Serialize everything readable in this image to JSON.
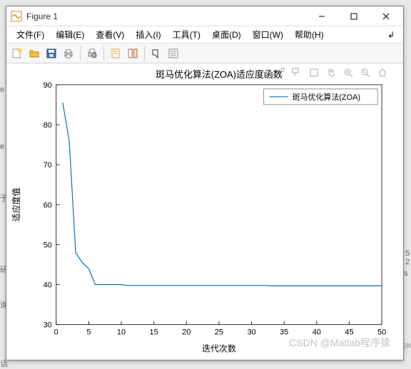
{
  "window": {
    "title": "Figure 1"
  },
  "menu": {
    "file": "文件(F)",
    "edit": "编辑(E)",
    "view": "查看(V)",
    "insert": "插入(I)",
    "tools": "工具(T)",
    "desktop": "桌面(D)",
    "window": "窗口(W)",
    "help": "帮助(H)"
  },
  "watermark": "CSDN @Matlab程序猿",
  "chart_data": {
    "type": "line",
    "title": "斑马优化算法(ZOA)适应度函数",
    "xlabel": "迭代次数",
    "ylabel": "适应度值",
    "xlim": [
      0,
      50
    ],
    "ylim": [
      30,
      90
    ],
    "xticks": [
      0,
      5,
      10,
      15,
      20,
      25,
      30,
      35,
      40,
      45,
      50
    ],
    "yticks": [
      30,
      40,
      50,
      60,
      70,
      80,
      90
    ],
    "legend_position": "top-right",
    "series": [
      {
        "name": "斑马优化算法(ZOA)",
        "color": "#0072bd",
        "x": [
          1,
          2,
          3,
          4,
          5,
          6,
          7,
          8,
          9,
          10,
          11,
          12,
          13,
          14,
          15,
          16,
          17,
          18,
          19,
          20,
          21,
          22,
          23,
          24,
          25,
          26,
          27,
          28,
          29,
          30,
          31,
          32,
          33,
          34,
          35,
          36,
          37,
          38,
          39,
          40,
          41,
          42,
          43,
          44,
          45,
          46,
          47,
          48,
          49,
          50
        ],
        "y": [
          85.5,
          76.0,
          48.0,
          45.5,
          44.0,
          40.0,
          40.0,
          40.0,
          40.0,
          40.0,
          39.8,
          39.8,
          39.8,
          39.8,
          39.8,
          39.8,
          39.8,
          39.8,
          39.8,
          39.8,
          39.8,
          39.8,
          39.8,
          39.8,
          39.8,
          39.8,
          39.8,
          39.8,
          39.8,
          39.8,
          39.8,
          39.8,
          39.7,
          39.7,
          39.7,
          39.7,
          39.7,
          39.7,
          39.7,
          39.7,
          39.7,
          39.7,
          39.7,
          39.7,
          39.7,
          39.7,
          39.7,
          39.7,
          39.7,
          39.7
        ]
      }
    ]
  }
}
